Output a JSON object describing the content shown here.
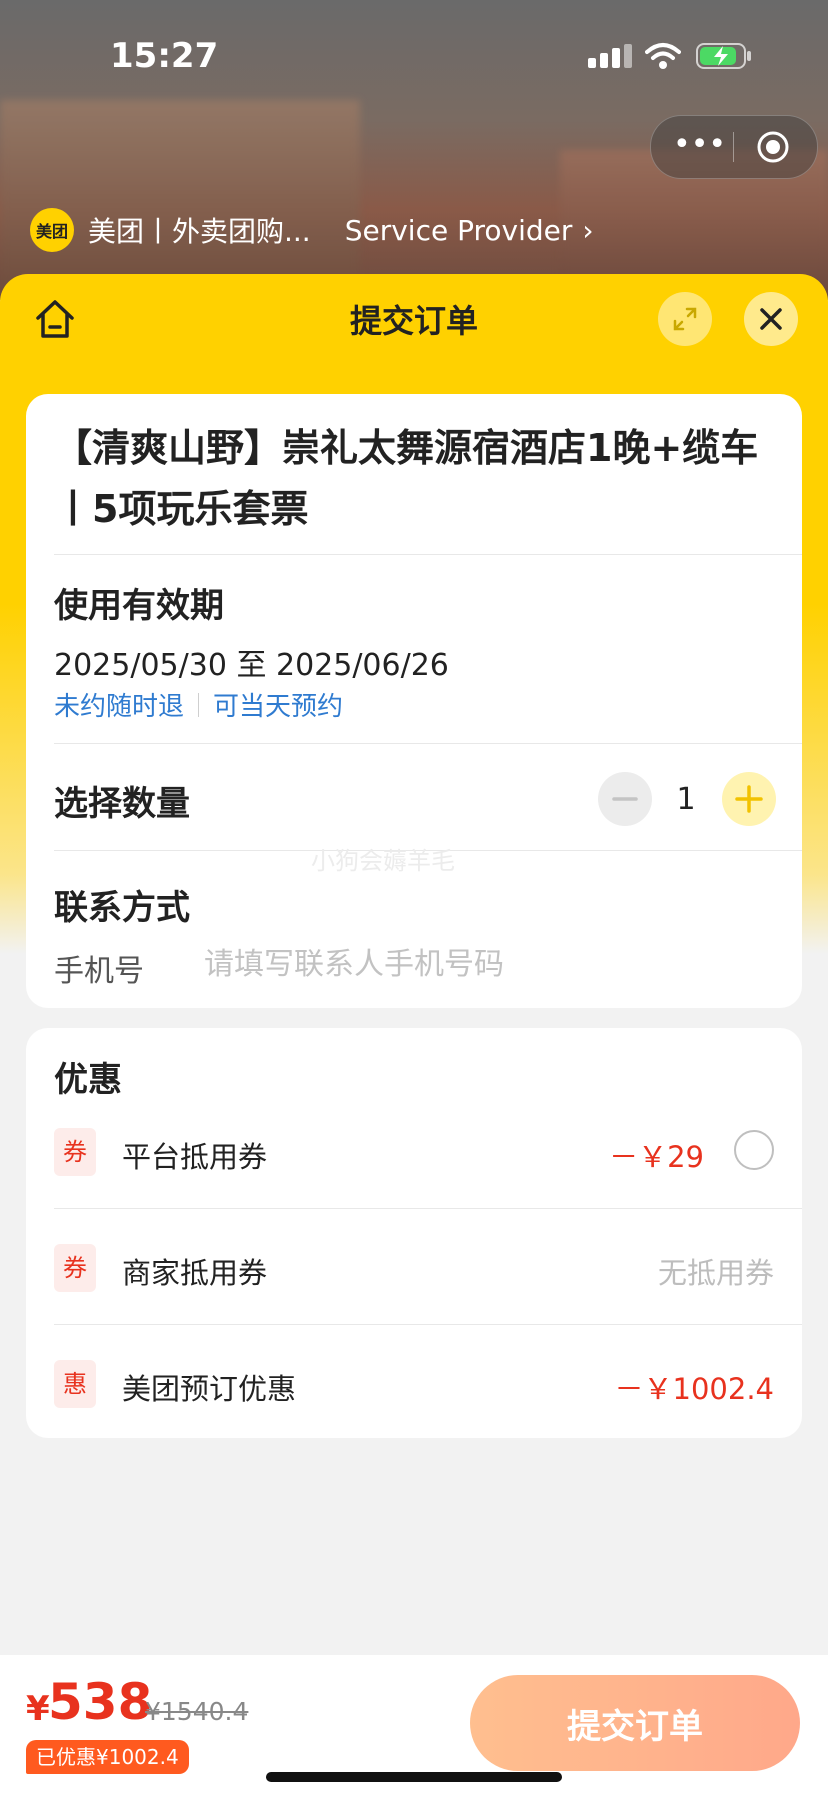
{
  "status_bar": {
    "time": "15:27"
  },
  "miniprogram": {
    "logo_text": "美团",
    "name": "美团丨外卖团购...",
    "provider_label": "Service Provider",
    "more_glyph": "•••"
  },
  "sheet": {
    "title": "提交订单"
  },
  "product": {
    "title": "【清爽山野】崇礼太舞源宿酒店1晚+缆车丨5项玩乐套票",
    "validity_label": "使用有效期",
    "validity_dates": "2025/05/30 至 2025/06/26",
    "tags": [
      "未约随时退",
      "可当天预约"
    ]
  },
  "quantity": {
    "label": "选择数量",
    "value": "1"
  },
  "watermark": "小狗会薅羊毛",
  "contact": {
    "label": "联系方式",
    "phone_label": "手机号",
    "phone_placeholder": "请填写联系人手机号码"
  },
  "discounts": {
    "title": "优惠",
    "items": [
      {
        "badge": "券",
        "name": "平台抵用券",
        "value": "－￥29"
      },
      {
        "badge": "券",
        "name": "商家抵用券",
        "value": "无抵用券"
      },
      {
        "badge": "惠",
        "name": "美团预订优惠",
        "value": "－￥1002.4"
      }
    ]
  },
  "footer": {
    "currency": "¥",
    "price": "538",
    "original_price": "¥1540.4",
    "saved_label": "已优惠¥1002.4",
    "submit_label": "提交订单"
  },
  "colors": {
    "brand_yellow": "#ffd100",
    "price_red": "#e8321e",
    "link_blue": "#2f7bd0",
    "submit_gradient_start": "#ffbf8f",
    "submit_gradient_end": "#ffa88a"
  }
}
